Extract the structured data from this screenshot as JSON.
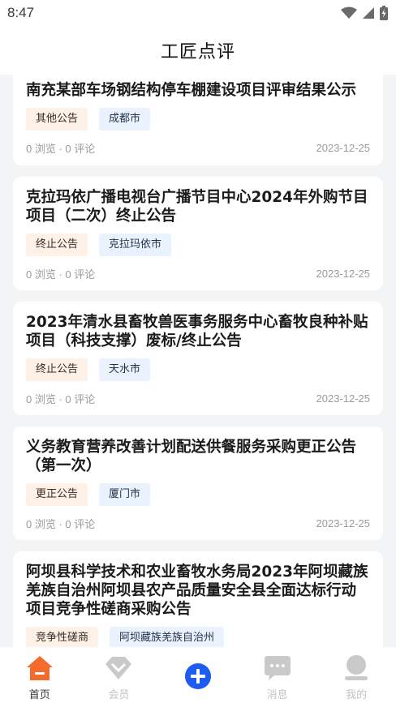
{
  "status_bar": {
    "time": "8:47"
  },
  "header": {
    "title": "工匠点评"
  },
  "cards": [
    {
      "title": "南充某部车场钢结构停车棚建设项目评审结果公示",
      "tag_type": "其他公告",
      "tag_city": "成都市",
      "stats": "0 浏览 · 0 评论",
      "date": "2023-12-25"
    },
    {
      "title": "克拉玛依广播电视台广播节目中心2024年外购节目项目（二次）终止公告",
      "tag_type": "终止公告",
      "tag_city": "克拉玛依市",
      "stats": "0 浏览 · 0 评论",
      "date": "2023-12-25"
    },
    {
      "title": "2023年清水县畜牧兽医事务服务中心畜牧良种补贴项目（科技支撑）废标/终止公告",
      "tag_type": "终止公告",
      "tag_city": "天水市",
      "stats": "0 浏览 · 0 评论",
      "date": "2023-12-25"
    },
    {
      "title": "义务教育营养改善计划配送供餐服务采购更正公告（第一次）",
      "tag_type": "更正公告",
      "tag_city": "厦门市",
      "stats": "0 浏览 · 0 评论",
      "date": "2023-12-25"
    },
    {
      "title": "阿坝县科学技术和农业畜牧水务局2023年阿坝藏族羌族自治州阿坝县农产品质量安全县全面达标行动项目竞争性磋商采购公告",
      "tag_type": "竞争性磋商",
      "tag_city": "阿坝藏族羌族自治州",
      "stats": "",
      "date": ""
    }
  ],
  "nav": {
    "home": "首页",
    "member": "会员",
    "messages": "消息",
    "mine": "我的"
  },
  "colors": {
    "accent": "#f46b2e",
    "add_button": "#1e5bf0",
    "inactive_icon": "#c9c9c9"
  }
}
